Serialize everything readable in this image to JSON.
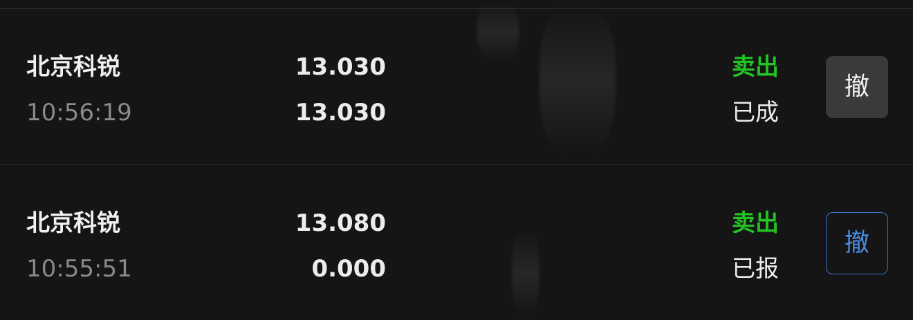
{
  "orders": [
    {
      "stock_name": "北京科锐",
      "time": "10:56:19",
      "order_price": "13.030",
      "deal_price": "13.030",
      "side": "卖出",
      "status": "已成",
      "cancel_label": "撤",
      "cancel_style": "filled"
    },
    {
      "stock_name": "北京科锐",
      "time": "10:55:51",
      "order_price": "13.080",
      "deal_price": "0.000",
      "side": "卖出",
      "status": "已报",
      "cancel_label": "撤",
      "cancel_style": "outlined"
    }
  ],
  "colors": {
    "background": "#151516",
    "sell": "#22c322",
    "cancel_outline": "#3b74bf",
    "cancel_filled_bg": "#3a3a3c"
  }
}
